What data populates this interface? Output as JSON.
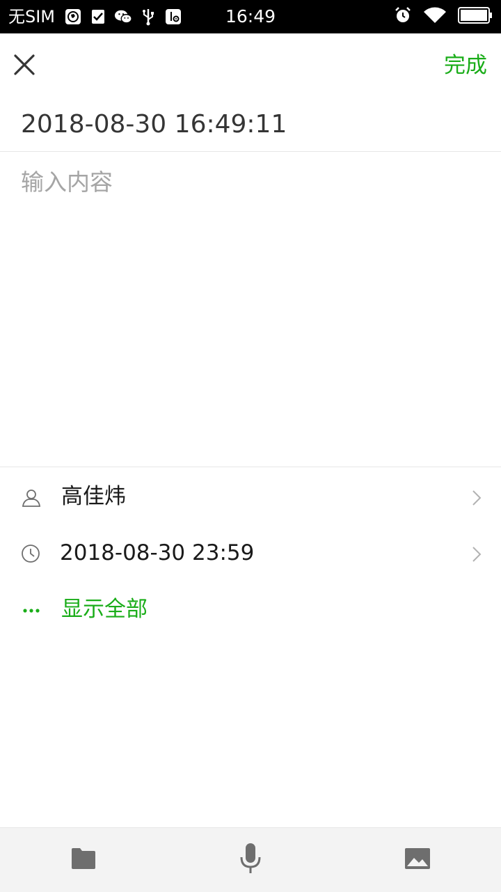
{
  "status_bar": {
    "carrier": "无SIM",
    "time": "16:49",
    "left_icons": [
      "vpn-globe-icon",
      "checkbox-notification-icon",
      "wechat-icon",
      "usb-icon",
      "usb-debug-icon"
    ],
    "right_icons": [
      "alarm-icon",
      "wifi-icon",
      "battery-icon"
    ],
    "battery_level": 1.0
  },
  "header": {
    "close_icon": "close-icon",
    "done_label": "完成",
    "timestamp": "2018-08-30 16:49:11"
  },
  "editor": {
    "placeholder": "输入内容",
    "value": ""
  },
  "info_rows": {
    "assignee": {
      "icon": "person-icon",
      "label": "高佳炜"
    },
    "due": {
      "icon": "clock-icon",
      "label": "2018-08-30 23:59"
    },
    "show_all": {
      "icon": "more-dots-icon",
      "label": "显示全部"
    }
  },
  "toolbar": {
    "items": [
      "folder-icon",
      "microphone-icon",
      "image-icon"
    ]
  },
  "colors": {
    "accent": "#1aad19",
    "text": "#1a1a1a",
    "placeholder": "#a5a5a5",
    "toolbar_bg": "#f3f3f3",
    "icon_gray": "#6e6e6e"
  }
}
